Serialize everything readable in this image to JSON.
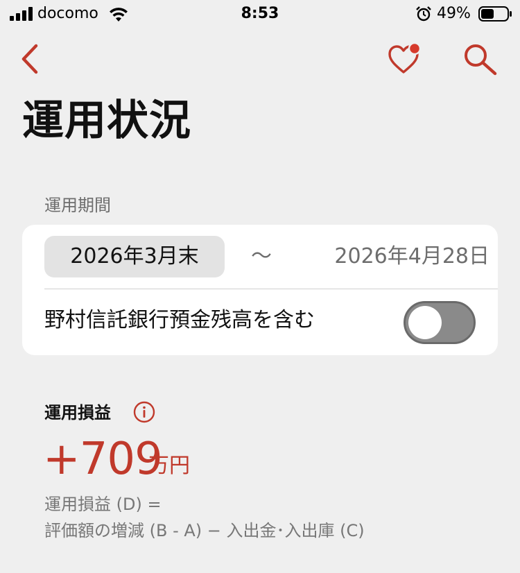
{
  "status_bar": {
    "carrier": "docomo",
    "time": "8:53",
    "battery_percent": "49%",
    "icons": [
      "signal-icon",
      "wifi-icon",
      "alarm-icon",
      "battery-icon"
    ]
  },
  "nav": {
    "icons": [
      "chevron-left-icon",
      "heart-notification-icon",
      "search-icon"
    ],
    "accent_color": "#c0392b"
  },
  "page": {
    "title": "運用状況"
  },
  "period": {
    "label": "運用期間",
    "from": "2026年3月末",
    "separator": "〜",
    "to": "2026年4月28日"
  },
  "toggle": {
    "label": "野村信託銀行預金残高を含む",
    "on": false
  },
  "profit": {
    "label": "運用損益",
    "value": "+709",
    "unit": "万円",
    "value_color": "#c0392b",
    "formula_line1": "運用損益 (D)  =",
    "formula_line2": "評価額の増減 (B - A)  −  入出金･入出庫 (C)"
  }
}
